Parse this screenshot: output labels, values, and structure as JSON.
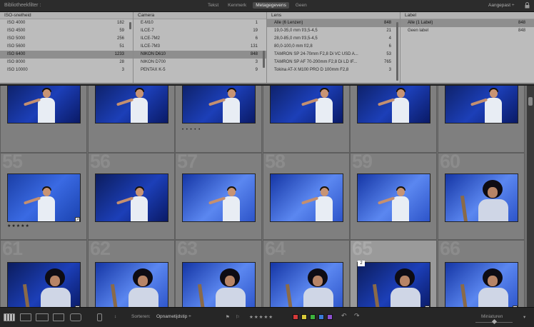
{
  "app": {
    "title": "Bibliotheekfilter :"
  },
  "filter_tabs": {
    "tekst": "Tekst",
    "kenmerk": "Kenmerk",
    "metagegevens": "Metagegevens",
    "geen": "Geen"
  },
  "preset": {
    "label": "Aangepast ÷"
  },
  "columns": {
    "iso": {
      "header": "ISO-snelheid",
      "items": [
        {
          "label": "ISO 4000",
          "count": "182"
        },
        {
          "label": "ISO 4500",
          "count": "59"
        },
        {
          "label": "ISO 5000",
          "count": "256"
        },
        {
          "label": "ISO 5600",
          "count": "51"
        },
        {
          "label": "ISO 6400",
          "count": "1233"
        },
        {
          "label": "ISO 8000",
          "count": "28"
        },
        {
          "label": "ISO 10000",
          "count": "3"
        }
      ]
    },
    "camera": {
      "header": "Camera",
      "items": [
        {
          "label": "E-M10",
          "count": "1"
        },
        {
          "label": "ILCE-7",
          "count": "19"
        },
        {
          "label": "ILCE-7M2",
          "count": "6"
        },
        {
          "label": "ILCE-7M3",
          "count": "131"
        },
        {
          "label": "NIKON D610",
          "count": "848"
        },
        {
          "label": "NIKON D700",
          "count": "3"
        },
        {
          "label": "PENTAX K-5",
          "count": "9"
        }
      ]
    },
    "lens": {
      "header": "Lens",
      "items": [
        {
          "label": "Alle (6 Lenzen)",
          "count": "848"
        },
        {
          "label": "19,0-35,0 mm f/3,5-4,5",
          "count": "21"
        },
        {
          "label": "28,0-85,0 mm f/3,5-4,5",
          "count": "4"
        },
        {
          "label": "80,0-100,0 mm f/2,8",
          "count": "6"
        },
        {
          "label": "TAMRON SP 24-70mm F2,8 Di VC USD A...",
          "count": "53"
        },
        {
          "label": "TAMRON SP AF 70-200mm F2,8 Di LD IF...",
          "count": "765"
        },
        {
          "label": "Tokina AT-X M100 PRO D 100mm F2,8",
          "count": "3"
        }
      ]
    },
    "label": {
      "header": "Label",
      "items": [
        {
          "label": "Alle (1 Label)",
          "count": "848"
        },
        {
          "label": "Geen label",
          "count": "848"
        }
      ]
    }
  },
  "grid": {
    "rows": [
      {
        "numbers": [
          "",
          "",
          "",
          "",
          "",
          ""
        ]
      },
      {
        "numbers": [
          "55",
          "56",
          "57",
          "58",
          "59",
          "60"
        ]
      },
      {
        "numbers": [
          "61",
          "62",
          "63",
          "64",
          "65",
          "66"
        ]
      }
    ],
    "row0_stars": "• • • • •",
    "row1_stars": "★★★★★",
    "selected_badge": "2",
    "badge_icon": "↗"
  },
  "toolbar": {
    "sort_label": "Sorteren:",
    "sort_value": "Opnametijdstip ÷",
    "rating_stars": "★★★★★",
    "thumbnails_label": "Miniaturen",
    "color_labels": [
      "#d43a3a",
      "#d8c93a",
      "#3db23d",
      "#3a7ad8",
      "#8c4fcf"
    ]
  }
}
